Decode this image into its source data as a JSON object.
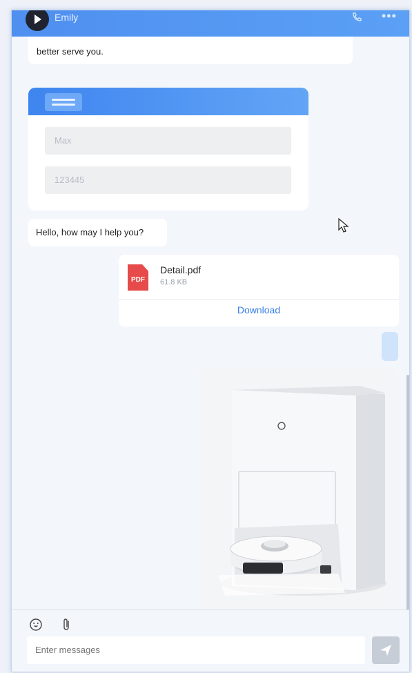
{
  "header": {
    "agent_name": "Emily"
  },
  "messages": {
    "intro_tail": "better serve you.",
    "form": {
      "name_value": "Max",
      "id_value": "123445"
    },
    "greeting": "Hello, how may I help you?",
    "file": {
      "icon_label": "PDF",
      "name": "Detail.pdf",
      "size": "61.8 KB",
      "download_label": "Download"
    }
  },
  "composer": {
    "placeholder": "Enter messages"
  },
  "colors": {
    "accent": "#4f8ff0",
    "outgoing": "#cfe3fb",
    "pdf": "#e64a4a"
  }
}
